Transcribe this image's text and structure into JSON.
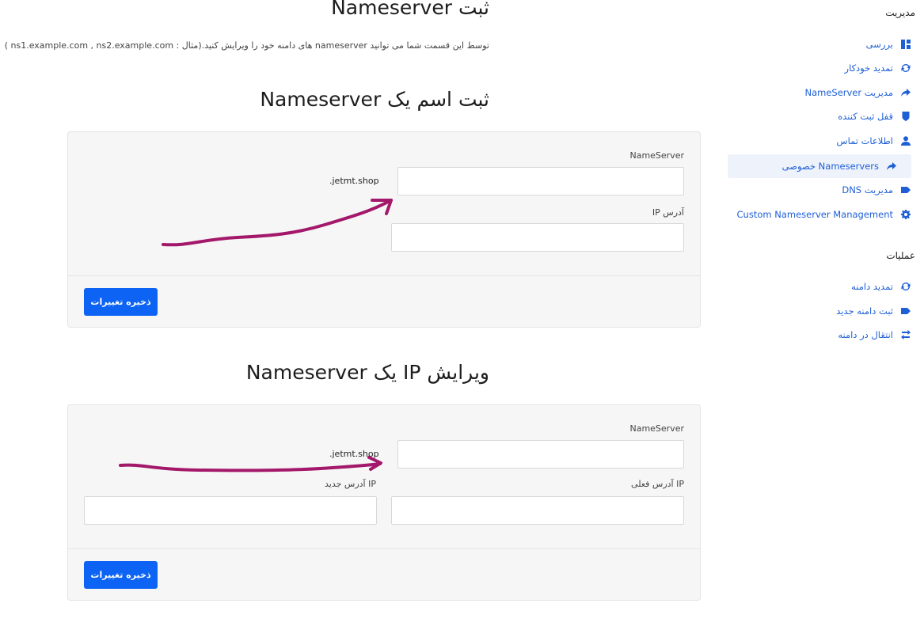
{
  "sidebar": {
    "manage_heading": "مدیریت",
    "manage_items": [
      {
        "label": "بررسی",
        "icon": "dashboard-icon"
      },
      {
        "label": "تمدید خودکار",
        "icon": "refresh-icon"
      },
      {
        "label": "مدیریت NameServer",
        "icon": "share-arrow-icon"
      },
      {
        "label": "قفل ثبت کننده",
        "icon": "shield-icon"
      },
      {
        "label": "اطلاعات تماس",
        "icon": "user-icon"
      },
      {
        "label": "Nameservers خصوصی",
        "icon": "share-arrow-icon"
      },
      {
        "label": "مدیریت DNS",
        "icon": "tag-icon"
      },
      {
        "label": "Custom Nameserver Management",
        "icon": "gear-icon"
      }
    ],
    "ops_heading": "عملیات",
    "ops_items": [
      {
        "label": "تمدید دامنه",
        "icon": "refresh-icon"
      },
      {
        "label": "ثبت دامنه جدید",
        "icon": "tag-icon"
      },
      {
        "label": "انتقال در دامنه",
        "icon": "transfer-icon"
      }
    ],
    "active_index": 5
  },
  "main": {
    "page_title": "ثبت Nameserver",
    "description": "توسط این قسمت شما می توانید nameserver های دامنه خود را ویرایش کنید.(مثال : ns1.example.com , ns2.example.com )",
    "register": {
      "title": "ثبت اسم یک Nameserver",
      "ns_label": "NameServer",
      "ns_value": "",
      "suffix": ".jetmt.shop",
      "ip_label": "آدرس IP",
      "ip_value": "",
      "save_label": "ذخیره تغییرات"
    },
    "modify": {
      "title": "ویرایش IP یک Nameserver",
      "ns_label": "NameServer",
      "ns_value": "",
      "suffix": ".jetmt.shop",
      "current_ip_label": "IP آدرس فعلی",
      "current_ip_value": "",
      "new_ip_label": "IP آدرس جدید",
      "new_ip_value": "",
      "save_label": "ذخیره تغییرات"
    }
  },
  "colors": {
    "accent": "#0d63f3",
    "link": "#1e5fd6",
    "annotation": "#a3186a"
  }
}
